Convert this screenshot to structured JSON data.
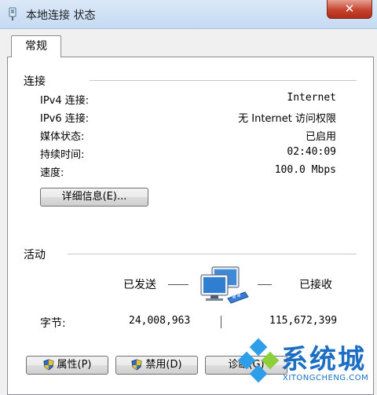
{
  "window": {
    "title": "本地连接 状态",
    "close_glyph": "✕"
  },
  "tabs": [
    {
      "label": "常规"
    }
  ],
  "connection": {
    "section_title": "连接",
    "rows": [
      {
        "label": "IPv4 连接:",
        "value": "Internet"
      },
      {
        "label": "IPv6 连接:",
        "value": "无 Internet 访问权限"
      },
      {
        "label": "媒体状态:",
        "value": "已启用"
      },
      {
        "label": "持续时间:",
        "value": "02:40:09"
      },
      {
        "label": "速度:",
        "value": "100.0 Mbps"
      }
    ],
    "details_button": "详细信息(E)..."
  },
  "activity": {
    "section_title": "活动",
    "sent_label": "已发送",
    "received_label": "已接收",
    "bytes_label": "字节:",
    "bytes_sent": "24,008,963",
    "bytes_received": "115,672,399"
  },
  "buttons": {
    "properties": "属性(P)",
    "disable": "禁用(D)",
    "diagnose": "诊断(G)"
  },
  "watermark": {
    "text": "系统城",
    "sub": "XITONGCHENG.COM"
  },
  "colors": {
    "titlebar": "#c5daf2",
    "close": "#c6442e",
    "watermark": "#1b6ec2"
  }
}
